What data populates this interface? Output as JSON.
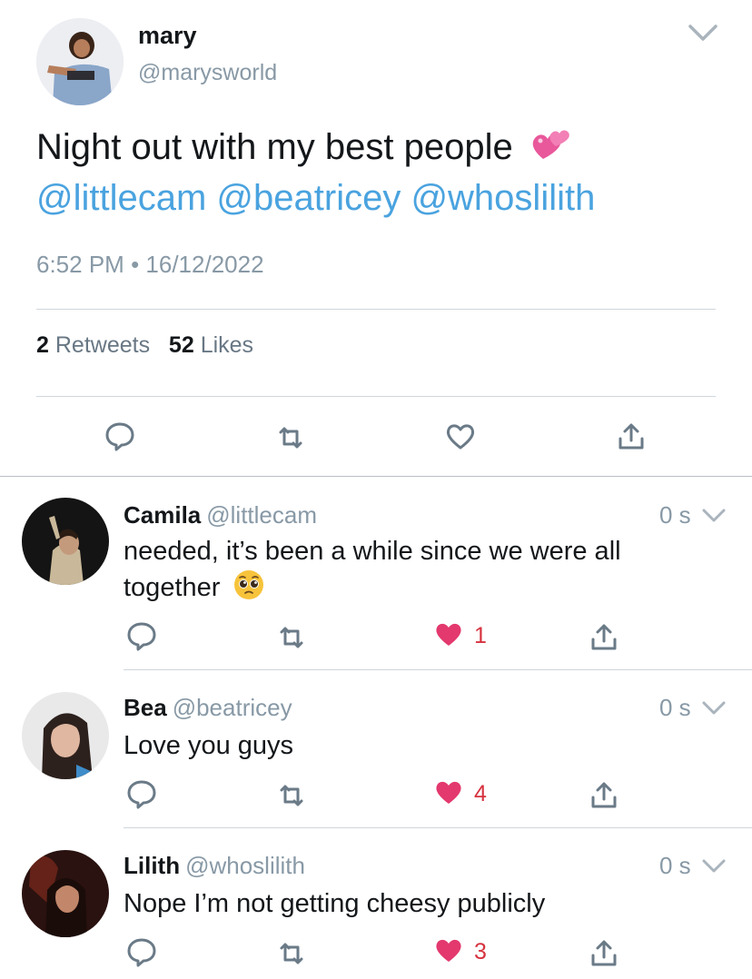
{
  "tweet": {
    "name": "mary",
    "handle": "@marysworld",
    "text": "Night out with my best people",
    "mentions": "@littlecam @beatricey @whoslilith",
    "time": "6:52 PM",
    "separator": "•",
    "date": "16/12/2022",
    "retweets_count": "2",
    "retweets_label": "Retweets",
    "likes_count": "52",
    "likes_label": "Likes"
  },
  "icons": {
    "reply": "reply-icon",
    "retweet": "retweet-icon",
    "like": "heart-icon",
    "share": "share-icon",
    "menu": "chevron-down-icon"
  },
  "colors": {
    "mention": "#4aa3df",
    "like_active": "#e0245e",
    "muted": "#8899a6"
  },
  "replies": [
    {
      "name": "Camila",
      "handle": "@littlecam",
      "time": "0 s",
      "line1": "needed, it’s been a while since we were all",
      "line2": "together",
      "likes": "1"
    },
    {
      "name": "Bea",
      "handle": "@beatricey",
      "time": "0 s",
      "line1": "Love you guys",
      "line2": "",
      "likes": "4"
    },
    {
      "name": "Lilith",
      "handle": "@whoslilith",
      "time": "0 s",
      "line1": "Nope I’m not getting cheesy publicly",
      "line2": "",
      "likes": "3"
    }
  ]
}
